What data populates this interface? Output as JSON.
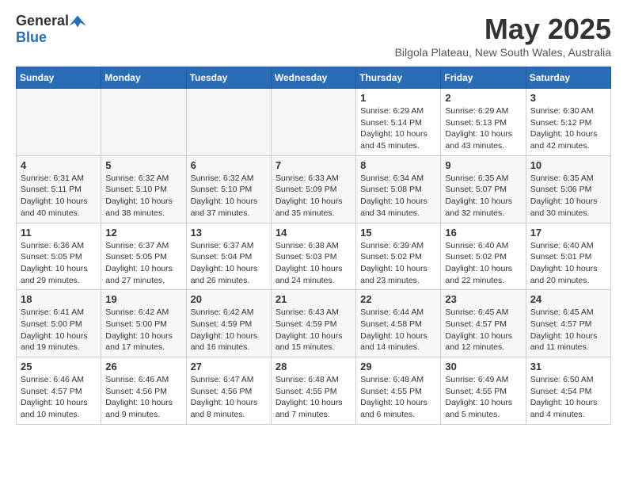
{
  "logo": {
    "general": "General",
    "blue": "Blue"
  },
  "title": {
    "month_year": "May 2025",
    "location": "Bilgola Plateau, New South Wales, Australia"
  },
  "weekdays": [
    "Sunday",
    "Monday",
    "Tuesday",
    "Wednesday",
    "Thursday",
    "Friday",
    "Saturday"
  ],
  "weeks": [
    [
      {
        "day": "",
        "empty": true
      },
      {
        "day": "",
        "empty": true
      },
      {
        "day": "",
        "empty": true
      },
      {
        "day": "",
        "empty": true
      },
      {
        "day": "1",
        "sunrise": "6:29 AM",
        "sunset": "5:14 PM",
        "daylight": "10 hours and 45 minutes."
      },
      {
        "day": "2",
        "sunrise": "6:29 AM",
        "sunset": "5:13 PM",
        "daylight": "10 hours and 43 minutes."
      },
      {
        "day": "3",
        "sunrise": "6:30 AM",
        "sunset": "5:12 PM",
        "daylight": "10 hours and 42 minutes."
      }
    ],
    [
      {
        "day": "4",
        "sunrise": "6:31 AM",
        "sunset": "5:11 PM",
        "daylight": "10 hours and 40 minutes."
      },
      {
        "day": "5",
        "sunrise": "6:32 AM",
        "sunset": "5:10 PM",
        "daylight": "10 hours and 38 minutes."
      },
      {
        "day": "6",
        "sunrise": "6:32 AM",
        "sunset": "5:10 PM",
        "daylight": "10 hours and 37 minutes."
      },
      {
        "day": "7",
        "sunrise": "6:33 AM",
        "sunset": "5:09 PM",
        "daylight": "10 hours and 35 minutes."
      },
      {
        "day": "8",
        "sunrise": "6:34 AM",
        "sunset": "5:08 PM",
        "daylight": "10 hours and 34 minutes."
      },
      {
        "day": "9",
        "sunrise": "6:35 AM",
        "sunset": "5:07 PM",
        "daylight": "10 hours and 32 minutes."
      },
      {
        "day": "10",
        "sunrise": "6:35 AM",
        "sunset": "5:06 PM",
        "daylight": "10 hours and 30 minutes."
      }
    ],
    [
      {
        "day": "11",
        "sunrise": "6:36 AM",
        "sunset": "5:05 PM",
        "daylight": "10 hours and 29 minutes."
      },
      {
        "day": "12",
        "sunrise": "6:37 AM",
        "sunset": "5:05 PM",
        "daylight": "10 hours and 27 minutes."
      },
      {
        "day": "13",
        "sunrise": "6:37 AM",
        "sunset": "5:04 PM",
        "daylight": "10 hours and 26 minutes."
      },
      {
        "day": "14",
        "sunrise": "6:38 AM",
        "sunset": "5:03 PM",
        "daylight": "10 hours and 24 minutes."
      },
      {
        "day": "15",
        "sunrise": "6:39 AM",
        "sunset": "5:02 PM",
        "daylight": "10 hours and 23 minutes."
      },
      {
        "day": "16",
        "sunrise": "6:40 AM",
        "sunset": "5:02 PM",
        "daylight": "10 hours and 22 minutes."
      },
      {
        "day": "17",
        "sunrise": "6:40 AM",
        "sunset": "5:01 PM",
        "daylight": "10 hours and 20 minutes."
      }
    ],
    [
      {
        "day": "18",
        "sunrise": "6:41 AM",
        "sunset": "5:00 PM",
        "daylight": "10 hours and 19 minutes."
      },
      {
        "day": "19",
        "sunrise": "6:42 AM",
        "sunset": "5:00 PM",
        "daylight": "10 hours and 17 minutes."
      },
      {
        "day": "20",
        "sunrise": "6:42 AM",
        "sunset": "4:59 PM",
        "daylight": "10 hours and 16 minutes."
      },
      {
        "day": "21",
        "sunrise": "6:43 AM",
        "sunset": "4:59 PM",
        "daylight": "10 hours and 15 minutes."
      },
      {
        "day": "22",
        "sunrise": "6:44 AM",
        "sunset": "4:58 PM",
        "daylight": "10 hours and 14 minutes."
      },
      {
        "day": "23",
        "sunrise": "6:45 AM",
        "sunset": "4:57 PM",
        "daylight": "10 hours and 12 minutes."
      },
      {
        "day": "24",
        "sunrise": "6:45 AM",
        "sunset": "4:57 PM",
        "daylight": "10 hours and 11 minutes."
      }
    ],
    [
      {
        "day": "25",
        "sunrise": "6:46 AM",
        "sunset": "4:57 PM",
        "daylight": "10 hours and 10 minutes."
      },
      {
        "day": "26",
        "sunrise": "6:46 AM",
        "sunset": "4:56 PM",
        "daylight": "10 hours and 9 minutes."
      },
      {
        "day": "27",
        "sunrise": "6:47 AM",
        "sunset": "4:56 PM",
        "daylight": "10 hours and 8 minutes."
      },
      {
        "day": "28",
        "sunrise": "6:48 AM",
        "sunset": "4:55 PM",
        "daylight": "10 hours and 7 minutes."
      },
      {
        "day": "29",
        "sunrise": "6:48 AM",
        "sunset": "4:55 PM",
        "daylight": "10 hours and 6 minutes."
      },
      {
        "day": "30",
        "sunrise": "6:49 AM",
        "sunset": "4:55 PM",
        "daylight": "10 hours and 5 minutes."
      },
      {
        "day": "31",
        "sunrise": "6:50 AM",
        "sunset": "4:54 PM",
        "daylight": "10 hours and 4 minutes."
      }
    ]
  ]
}
